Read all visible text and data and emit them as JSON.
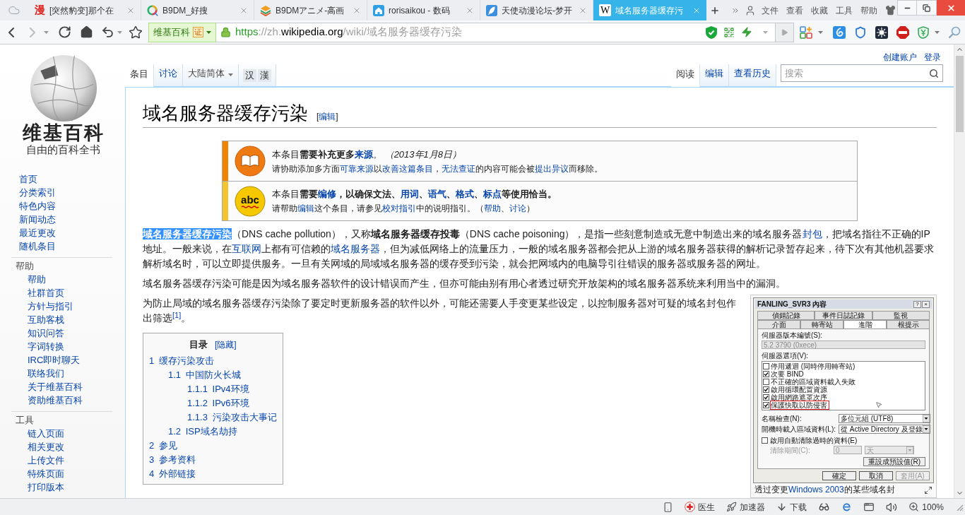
{
  "browser": {
    "tabs": [
      {
        "title": "[突然豹变]那个在",
        "kind": "calligraphy",
        "glyph": "漫",
        "selected": false
      },
      {
        "title": "B9DM_好搜",
        "kind": "ring",
        "selected": false
      },
      {
        "title": "B9DMアニメ-高画",
        "kind": "layers",
        "selected": false
      },
      {
        "title": "rorisaikou - 数码",
        "kind": "house",
        "selected": false
      },
      {
        "title": "天使动漫论坛-梦开",
        "kind": "feather",
        "selected": false
      },
      {
        "title": "域名服务器缓存污",
        "kind": "letter_tile",
        "glyph": "W",
        "selected": true
      }
    ],
    "menu": [
      "文件",
      "查看",
      "收藏",
      "工具",
      "帮助"
    ],
    "site_badge": {
      "label": "维基百科",
      "certificate": "证"
    },
    "address": {
      "scheme": "https",
      "separator": "://zh.",
      "domain": "wikipedia.org",
      "path": "/wiki/域名服务器缓存污染"
    }
  },
  "page": {
    "personal_links": [
      "创建账户",
      "登录"
    ],
    "logo": {
      "wordmark": "维基百科",
      "tagline": "自由的百科全书"
    },
    "nav": [
      {
        "items": [
          "首页",
          "分类索引",
          "特色内容",
          "新闻动态",
          "最近更改",
          "随机条目"
        ]
      },
      {
        "heading": "帮助",
        "items": [
          "帮助",
          "社群首页",
          "方针与指引",
          "互助客栈",
          "知识问答",
          "字词转换",
          "IRC即时聊天",
          "联络我们",
          "关于维基百科",
          "资助维基百科"
        ]
      },
      {
        "heading": "工具",
        "items": [
          "链入页面",
          "相关更改",
          "上传文件",
          "特殊页面",
          "打印版本"
        ]
      }
    ],
    "namespace_tabs": [
      {
        "label": "条目",
        "selected": true
      },
      {
        "label": "讨论",
        "selected": false
      }
    ],
    "variant_menu": {
      "label": "大陆简体"
    },
    "script_buttons": [
      "汉",
      "漢"
    ],
    "view_tabs": [
      {
        "label": "阅读",
        "selected": true
      },
      {
        "label": "编辑",
        "selected": false
      },
      {
        "label": "查看历史",
        "selected": false
      }
    ],
    "search": {
      "placeholder": "搜索"
    }
  },
  "article": {
    "title": "域名服务器缓存污染",
    "title_edit": [
      {
        "kind": "text",
        "text": "["
      },
      {
        "kind": "link",
        "text": "编辑",
        "bold": false
      },
      {
        "kind": "text",
        "text": "]"
      }
    ],
    "notices": [
      {
        "kind": "book",
        "color": "#f28500",
        "lines": [
          [
            {
              "kind": "text",
              "text": "本条目**需要补充更多**"
            },
            {
              "kind": "link",
              "text": "来源",
              "bold": true
            },
            {
              "kind": "text",
              "text": "。 *（2013年1月8日）*"
            }
          ],
          [
            {
              "kind": "text",
              "text": "请协助添加多方面"
            },
            {
              "kind": "link",
              "text": "可靠来源",
              "bold": false
            },
            {
              "kind": "text",
              "text": "以"
            },
            {
              "kind": "link",
              "text": "改善这篇条目",
              "bold": false
            },
            {
              "kind": "text",
              "text": "，"
            },
            {
              "kind": "link",
              "text": "无法查证",
              "bold": false
            },
            {
              "kind": "text",
              "text": "的内容可能会被"
            },
            {
              "kind": "link",
              "text": "提出异议",
              "bold": false
            },
            {
              "kind": "text",
              "text": "而移除。"
            }
          ]
        ]
      },
      {
        "kind": "abc",
        "icon_text": "abc",
        "color": "#f4c430",
        "lines": [
          [
            {
              "kind": "text",
              "text": "本条目**需要**"
            },
            {
              "kind": "link",
              "text": "编修",
              "bold": true
            },
            {
              "kind": "text",
              "text": "**，以确保文法、**"
            },
            {
              "kind": "link",
              "text": "用词",
              "bold": true
            },
            {
              "kind": "text",
              "text": "**、**"
            },
            {
              "kind": "link",
              "text": "语气",
              "bold": true
            },
            {
              "kind": "text",
              "text": "**、**"
            },
            {
              "kind": "link",
              "text": "格式",
              "bold": true
            },
            {
              "kind": "text",
              "text": "**、**"
            },
            {
              "kind": "link",
              "text": "标点",
              "bold": true
            },
            {
              "kind": "text",
              "text": "**等使用恰当。**"
            }
          ],
          [
            {
              "kind": "text",
              "text": "请帮助"
            },
            {
              "kind": "link",
              "text": "编辑",
              "bold": false
            },
            {
              "kind": "text",
              "text": "这个条目，请参见"
            },
            {
              "kind": "link",
              "text": "校对指引",
              "bold": false
            },
            {
              "kind": "text",
              "text": "中的说明指引。（"
            },
            {
              "kind": "link",
              "text": "帮助",
              "bold": false
            },
            {
              "kind": "text",
              "text": "、"
            },
            {
              "kind": "link",
              "text": "讨论",
              "bold": false
            },
            {
              "kind": "text",
              "text": "）"
            }
          ]
        ]
      }
    ],
    "paragraphs": [
      [
        {
          "kind": "highlight",
          "text": "域名服务器缓存污染"
        },
        {
          "kind": "text",
          "text": "（DNS cache pollution），又称**域名服务器缓存投毒**（DNS cache poisoning），是指一些刻意制造或无意中制造出来的域名服务器"
        },
        {
          "kind": "link",
          "text": "封包",
          "bold": false
        },
        {
          "kind": "text",
          "text": "，把域名指往不正确的IP地址。一般来说，在"
        },
        {
          "kind": "link",
          "text": "互联网",
          "bold": false
        },
        {
          "kind": "text",
          "text": "上都有可信赖的"
        },
        {
          "kind": "link",
          "text": "域名服务器",
          "bold": false
        },
        {
          "kind": "text",
          "text": "，但为减低网络上的流量压力，一般的域名服务器都会把从上游的域名服务器获得的解析记录暂存起来，待下次有其他机器要求解析域名时，可以立即提供服务。一旦有关网域的局域域名服务器的缓存受到污染，就会把网域内的电脑导引往错误的服务器或服务器的网址。"
        }
      ],
      [
        {
          "kind": "text",
          "text": "域名服务器缓存污染可能是因为域名服务器软件的设计错误而产生，但亦可能由别有用心者透过研究开放架构的域名服务器系统来利用当中的漏洞。"
        }
      ],
      [
        {
          "kind": "text",
          "text": "为防止局域的域名服务器缓存污染除了要定时更新服务器的软件以外，可能还需要人手变更某些设定，以控制服务器对可疑的域名封包作出筛选"
        },
        {
          "kind": "ref",
          "text": "[1]"
        },
        {
          "kind": "text",
          "text": "。"
        }
      ]
    ],
    "figure": {
      "dialog": {
        "title": "FANLING_SVR3 內容",
        "title_buttons": [
          "?",
          "×"
        ],
        "tab_rows": [
          [
            {
              "label": "偵錯記錄",
              "selected": false
            },
            {
              "label": "事件日誌記錄",
              "selected": false
            },
            {
              "label": "監視",
              "selected": false
            }
          ],
          [
            {
              "label": "介面",
              "selected": false
            },
            {
              "label": "轉寄站",
              "selected": false
            },
            {
              "label": "進階",
              "selected": true
            },
            {
              "label": "根提示",
              "selected": false
            }
          ]
        ],
        "version": {
          "label": "伺服器版本編號(S):",
          "value": "5.2 3790 (0xece)",
          "disabled": true
        },
        "options_label": "伺服器選項(V):",
        "options": [
          {
            "label": "停用遞迴 (同時停用轉寄站)",
            "checked": false,
            "marked": false
          },
          {
            "label": "次要 BIND",
            "checked": true,
            "marked": false
          },
          {
            "label": "不正確的區域資料載入失敗",
            "checked": false,
            "marked": false
          },
          {
            "label": "啟用循環配置資源",
            "checked": true,
            "marked": false
          },
          {
            "label": "啟用網路遮罩次序",
            "checked": true,
            "marked": false
          },
          {
            "label": "保護快取以防侵害",
            "checked": true,
            "marked": true
          }
        ],
        "selects": [
          {
            "label": "名稱檢查(N):",
            "value": "多位元組 (UTF8)"
          },
          {
            "label": "開機時載入區域資料(L):",
            "value": "從 Active Directory 及登錄"
          }
        ],
        "scavenging": {
          "label": "啟用自動清除過時的資料(E)",
          "checked": false
        },
        "period": {
          "label": "清除期間(C):",
          "value": "0",
          "unit": "天",
          "disabled": true
        },
        "reset_button": "重設成預設值(R)",
        "buttons": [
          {
            "label": "確定",
            "disabled": false
          },
          {
            "label": "取消",
            "disabled": false
          },
          {
            "label": "套用(A)",
            "disabled": true
          }
        ]
      },
      "caption": [
        {
          "kind": "text",
          "text": "透过变更"
        },
        {
          "kind": "link",
          "text": "Windows 2003",
          "bold": false
        },
        {
          "kind": "text",
          "text": "的某些域名封"
        }
      ]
    },
    "toc": {
      "title": "目录",
      "toggle": "[隐藏]",
      "items": [
        {
          "number": "1",
          "label": "缓存污染攻击",
          "children": [
            {
              "number": "1.1",
              "label": "中国防火长城",
              "children": [
                {
                  "number": "1.1.1",
                  "label": "IPv4环境"
                },
                {
                  "number": "1.1.2",
                  "label": "IPv6环境"
                },
                {
                  "number": "1.1.3",
                  "label": "污染攻击大事记"
                }
              ]
            },
            {
              "number": "1.2",
              "label": "ISP域名劫持"
            }
          ]
        },
        {
          "number": "2",
          "label": "参见"
        },
        {
          "number": "3",
          "label": "参考资料"
        },
        {
          "number": "4",
          "label": "外部链接"
        }
      ]
    }
  },
  "status_bar": [
    {
      "kind": "phone"
    },
    {
      "kind": "doctor",
      "label": "医生"
    },
    {
      "kind": "accelerator",
      "label": "加速器"
    },
    {
      "kind": "download",
      "label": "下载"
    },
    {
      "kind": "glasses"
    },
    {
      "kind": "e_logo"
    },
    {
      "kind": "window"
    },
    {
      "kind": "speaker"
    },
    {
      "kind": "zoom",
      "label": "100%"
    }
  ]
}
